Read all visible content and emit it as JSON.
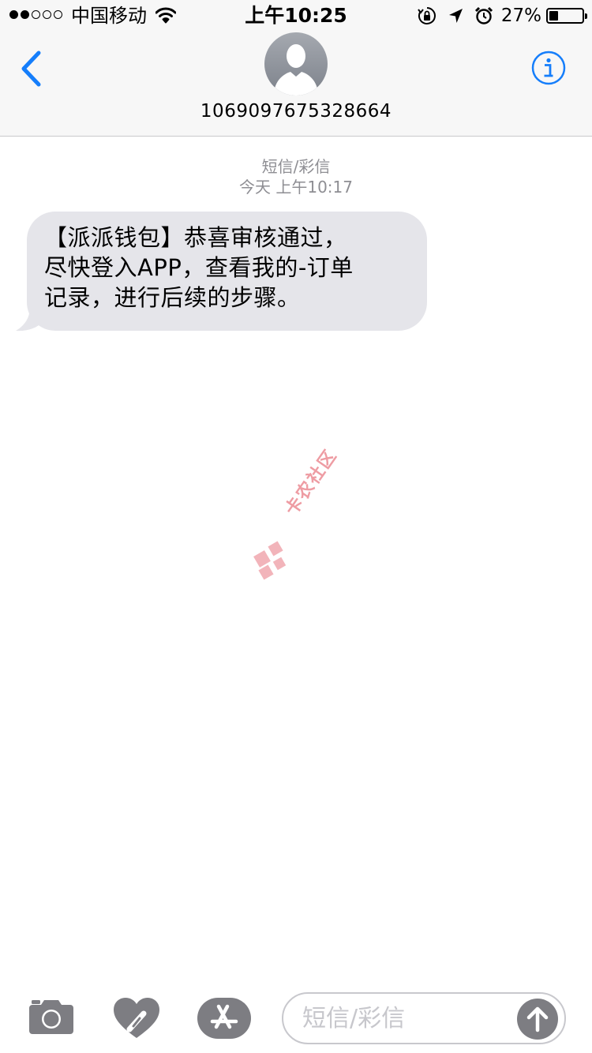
{
  "status_bar": {
    "carrier": "中国移动",
    "time": "上午10:25",
    "battery_percent": "27%",
    "battery_level": 0.27,
    "signal_strength": 2,
    "icons": [
      "wifi-icon",
      "rotation-lock-icon",
      "location-arrow-icon",
      "alarm-icon",
      "battery-icon"
    ]
  },
  "nav": {
    "back_icon": "chevron-left-icon",
    "contact_avatar_icon": "person-silhouette-icon",
    "contact_number": "1069097675328664",
    "info_icon": "info-circle-icon"
  },
  "conversation": {
    "service_label": "短信/彩信",
    "timestamp": "今天 上午10:17",
    "messages": [
      {
        "direction": "incoming",
        "lines": [
          "【派派钱包】恭喜审核通过，",
          "尽快登入APP，查看我的-订单",
          "记录，进行后续的步骤。"
        ]
      }
    ]
  },
  "watermark": {
    "text": "卡农社区",
    "icon": "kanong-logo-icon"
  },
  "compose": {
    "camera_icon": "camera-icon",
    "digital_touch_icon": "digital-touch-heart-icon",
    "app_store_icon": "app-store-icon",
    "placeholder": "短信/彩信",
    "value": "",
    "send_icon": "arrow-up-icon"
  },
  "colors": {
    "accent": "#157efb",
    "incoming_bubble": "#e5e5ea",
    "meta_text": "#8e8e93",
    "watermark": "#e35b67"
  }
}
